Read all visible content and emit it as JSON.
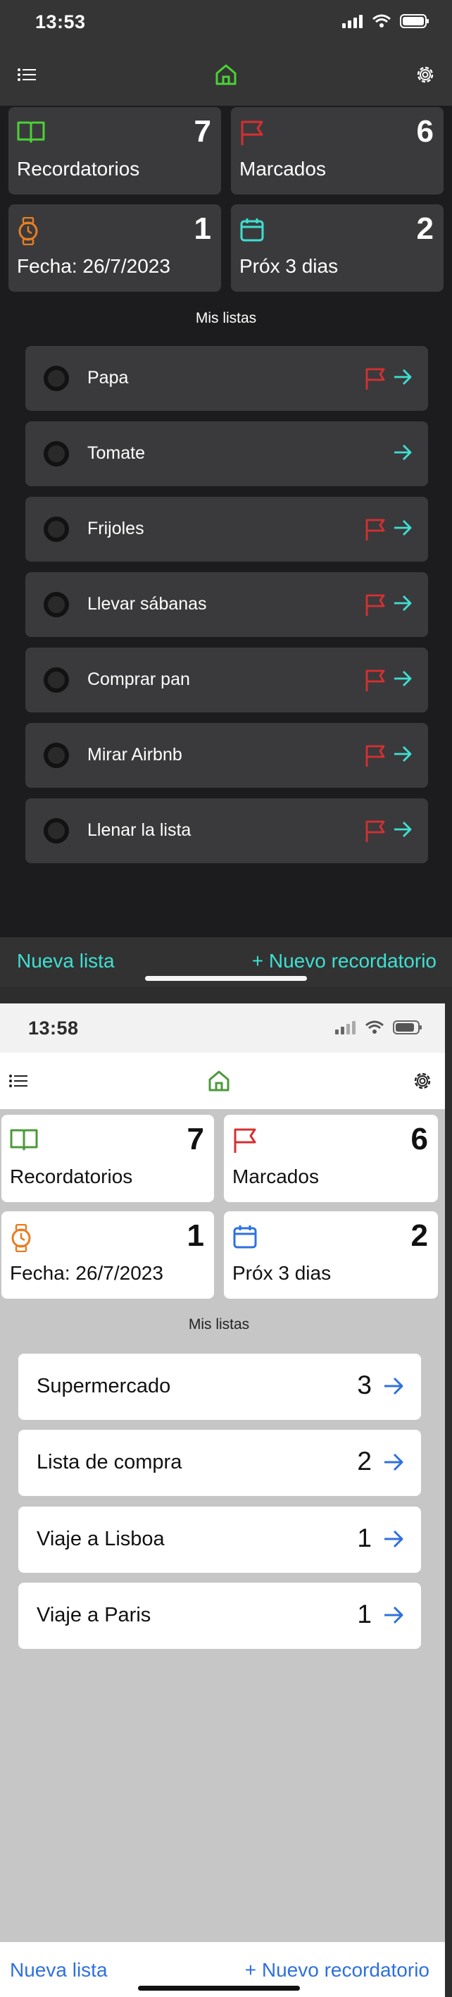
{
  "dark": {
    "status": {
      "time": "13:53"
    },
    "summary": [
      {
        "count": "7",
        "label": "Recordatorios",
        "icon": "book-icon",
        "color": "#4cd137"
      },
      {
        "count": "6",
        "label": "Marcados",
        "icon": "flag-icon",
        "color": "#d63031"
      },
      {
        "count": "1",
        "label": "Fecha: 26/7/2023",
        "icon": "watch-icon",
        "color": "#e67e22"
      },
      {
        "count": "2",
        "label": "Próx 3 dias",
        "icon": "calendar-icon",
        "color": "#3ee0d2"
      }
    ],
    "section_title": "Mis listas",
    "items": [
      {
        "label": "Papa",
        "flagged": true
      },
      {
        "label": "Tomate",
        "flagged": false
      },
      {
        "label": "Frijoles",
        "flagged": true
      },
      {
        "label": "Llevar sábanas",
        "flagged": true
      },
      {
        "label": "Comprar pan",
        "flagged": true
      },
      {
        "label": "Mirar Airbnb",
        "flagged": true
      },
      {
        "label": "Llenar la lista",
        "flagged": true
      }
    ],
    "bottom": {
      "new_list": "Nueva lista",
      "new_reminder": "+ Nuevo recordatorio"
    },
    "colors": {
      "accent": "#3ee0d2",
      "flag": "#d63031",
      "home": "#4cd137"
    }
  },
  "light": {
    "status": {
      "time": "13:58"
    },
    "summary": [
      {
        "count": "7",
        "label": "Recordatorios",
        "icon": "book-icon",
        "color": "#4c9a3a"
      },
      {
        "count": "6",
        "label": "Marcados",
        "icon": "flag-icon",
        "color": "#d63031"
      },
      {
        "count": "1",
        "label": "Fecha: 26/7/2023",
        "icon": "watch-icon",
        "color": "#e67e22"
      },
      {
        "count": "2",
        "label": "Próx 3 dias",
        "icon": "calendar-icon",
        "color": "#2f70df"
      }
    ],
    "section_title": "Mis listas",
    "lists": [
      {
        "label": "Supermercado",
        "count": "3"
      },
      {
        "label": "Lista de compra",
        "count": "2"
      },
      {
        "label": "Viaje a Lisboa",
        "count": "1"
      },
      {
        "label": "Viaje a Paris",
        "count": "1"
      }
    ],
    "bottom": {
      "new_list": "Nueva lista",
      "new_reminder": "+ Nuevo recordatorio"
    },
    "colors": {
      "accent": "#2f70df",
      "home": "#4c9a3a"
    }
  }
}
